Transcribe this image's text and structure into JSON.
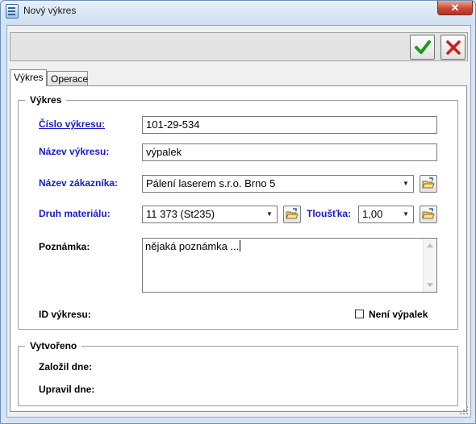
{
  "window": {
    "title": "Nový výkres",
    "close_label": "✕"
  },
  "toolbar": {
    "ok_icon": "checkmark-icon",
    "cancel_icon": "x-icon",
    "ok_color": "#1f9a1f",
    "cancel_color": "#c81e1e"
  },
  "tabs": [
    {
      "label": "Výkres",
      "active": true
    },
    {
      "label": "Operace",
      "active": false
    }
  ],
  "vykres_group": {
    "title": "Výkres",
    "cislo_label": "Číslo výkresu:",
    "cislo_value": "101-29-534",
    "nazev_label": "Název výkresu:",
    "nazev_value": "výpalek",
    "zakaznik_label": "Název zákazníka:",
    "zakaznik_value": "Pálení laserem s.r.o. Brno 5",
    "material_label": "Druh materiálu:",
    "material_value": "11 373 (St235)",
    "tloustka_label": "Tloušťka:",
    "tloustka_value": "1,00",
    "poznamka_label": "Poznámka:",
    "poznamka_value": "nějaká poznámka ...",
    "id_label": "ID výkresu:",
    "neni_vypalek_label": "Není výpalek",
    "neni_vypalek_checked": false
  },
  "vytvoreno_group": {
    "title": "Vytvořeno",
    "zalozil_label": "Založil dne:",
    "upravil_label": "Upravil dne:"
  }
}
